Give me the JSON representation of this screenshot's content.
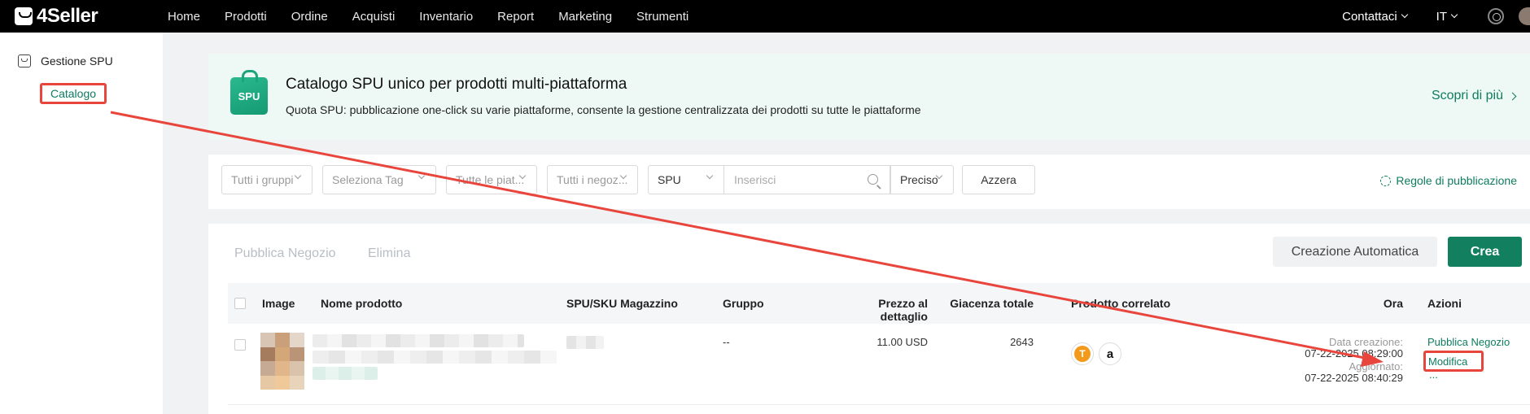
{
  "app": {
    "logo": "4Seller"
  },
  "nav": [
    "Home",
    "Prodotti",
    "Ordine",
    "Acquisti",
    "Inventario",
    "Report",
    "Marketing",
    "Strumenti"
  ],
  "header_right": {
    "contact": "Contattaci",
    "language": "IT"
  },
  "sidebar": {
    "section": "Gestione SPU",
    "item": "Catalogo"
  },
  "banner": {
    "badge": "SPU",
    "title": "Catalogo SPU unico per prodotti multi-piattaforma",
    "subtitle": "Quota SPU: pubblicazione one-click su varie piattaforme, consente la gestione centralizzata dei prodotti su tutte le piattaforme",
    "link": "Scopri di più"
  },
  "filters": {
    "groups": "Tutti i gruppi",
    "tags": "Seleziona Tag",
    "platforms": "Tutte le piat...",
    "shops": "Tutti i negoz...",
    "search_type": "SPU",
    "search_placeholder": "Inserisci",
    "match": "Preciso",
    "reset": "Azzera",
    "rules": "Regole di pubblicazione"
  },
  "toolbar": {
    "publish": "Pubblica Negozio",
    "delete": "Elimina",
    "auto_create": "Creazione Automatica",
    "create": "Crea"
  },
  "table": {
    "columns": [
      "Image",
      "Nome prodotto",
      "SPU/SKU Magazzino",
      "Gruppo",
      "Prezzo al dettaglio",
      "Giacenza totale",
      "Prodotto correlato",
      "Ora",
      "Azioni"
    ],
    "row": {
      "group": "--",
      "price": "11.00 USD",
      "stock": "2643",
      "related": [
        "T",
        "a"
      ],
      "created_label": "Data creazione:",
      "created_value": "07-22-2025 08:29:00",
      "updated_label": "Aggiornato:",
      "updated_value": "07-22-2025 08:40:29",
      "actions": [
        "Pubblica Negozio",
        "Modifica",
        "..."
      ]
    }
  },
  "colors": {
    "brand": "#12805e",
    "annotation": "#e8453c"
  }
}
